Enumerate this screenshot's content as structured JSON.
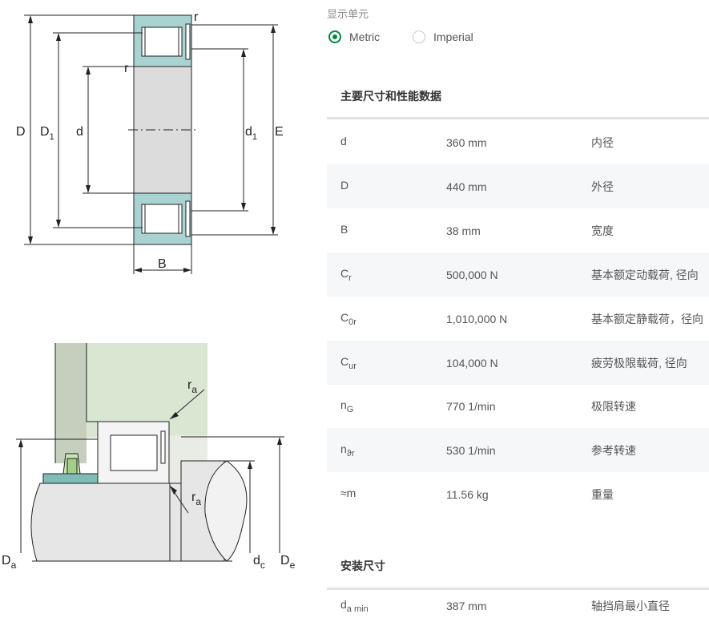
{
  "drawing": {
    "top_labels": {
      "r_top": "r",
      "r_mid": "r",
      "D": "D",
      "D1": "D",
      "D1_sub": "1",
      "d": "d",
      "d1": "d",
      "d1_sub": "1",
      "E": "E",
      "B": "B"
    },
    "bottom_labels": {
      "ra_top": "r",
      "ra_top_sub": "a",
      "ra_bottom": "r",
      "ra_bottom_sub": "a",
      "Da": "D",
      "Da_sub": "a",
      "dc": "d",
      "dc_sub": "c",
      "De": "D",
      "De_sub": "e"
    }
  },
  "units": {
    "label": "显示单元",
    "options": [
      {
        "label": "Metric",
        "selected": true
      },
      {
        "label": "Imperial",
        "selected": false
      }
    ]
  },
  "main_section": {
    "title": "主要尺寸和性能数据",
    "rows": [
      {
        "sym": "d",
        "sub": "",
        "value": "360 mm",
        "desc": "内径"
      },
      {
        "sym": "D",
        "sub": "",
        "value": "440 mm",
        "desc": "外径"
      },
      {
        "sym": "B",
        "sub": "",
        "value": "38 mm",
        "desc": "宽度"
      },
      {
        "sym": "C",
        "sub": "r",
        "value": "500,000 N",
        "desc": "基本额定动载荷, 径向"
      },
      {
        "sym": "C",
        "sub": "0r",
        "value": "1,010,000 N",
        "desc": "基本额定静载荷，径向"
      },
      {
        "sym": "C",
        "sub": "ur",
        "value": "104,000 N",
        "desc": "疲劳极限载荷, 径向"
      },
      {
        "sym": "n",
        "sub": "G",
        "value": "770 1/min",
        "desc": "极限转速"
      },
      {
        "sym": "n",
        "sub": "ϑr",
        "value": "530 1/min",
        "desc": "参考转速"
      },
      {
        "sym": "≈m",
        "sub": "",
        "value": "11.56 kg",
        "desc": "重量"
      }
    ]
  },
  "mount_section": {
    "title": "安装尺寸",
    "rows": [
      {
        "sym": "d",
        "sub": "a min",
        "value": "387 mm",
        "desc": "轴挡肩最小直径"
      }
    ]
  }
}
